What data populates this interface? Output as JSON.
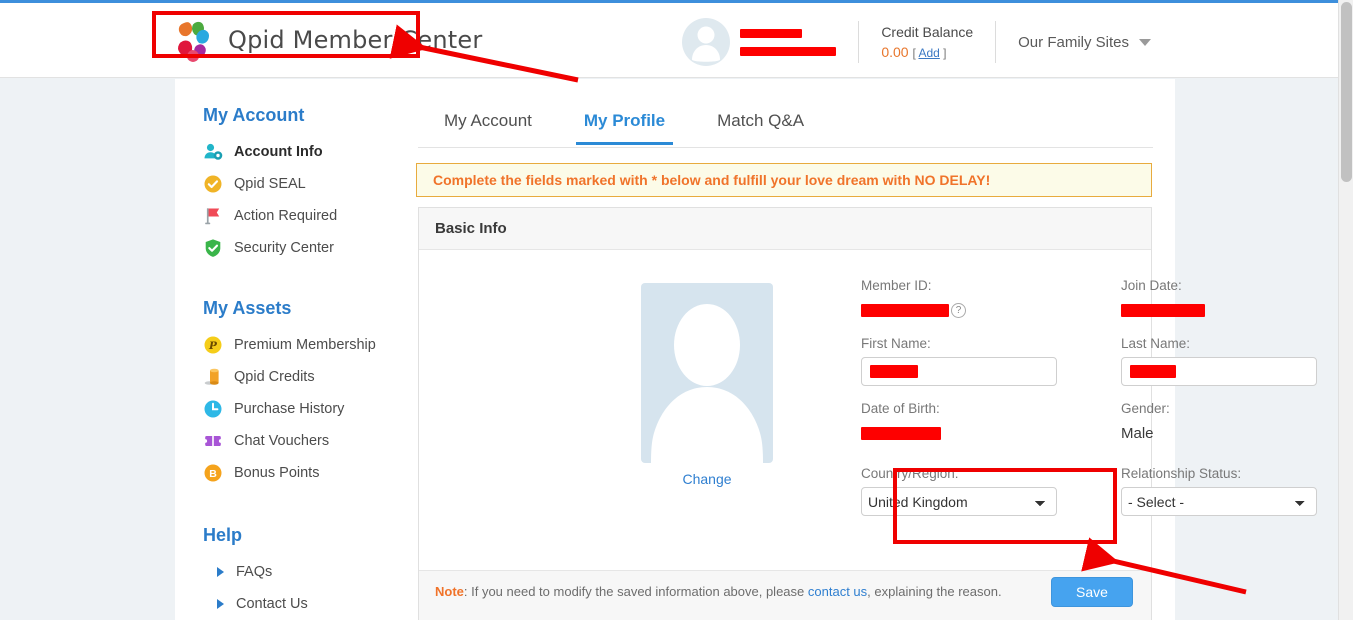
{
  "brand": {
    "title": "Qpid Member Center",
    "logo_icon": "qpid-flower-logo",
    "logo_colors": [
      "#e8762c",
      "#4caa3f",
      "#29a9e0",
      "#a62a9e",
      "#e0173c",
      "#e8486e"
    ]
  },
  "header": {
    "avatar_icon": "user-avatar-icon",
    "username_redacted": true,
    "credit": {
      "label": "Credit Balance",
      "value": "0.00",
      "add_open": "[",
      "add_label": "Add",
      "add_close": "]"
    },
    "family_sites": {
      "label": "Our Family Sites",
      "caret_icon": "chevron-down-icon"
    }
  },
  "sidebar": {
    "sections": [
      {
        "title": "My Account",
        "items": [
          {
            "label": "Account Info",
            "icon": "user-gear-icon",
            "active": true
          },
          {
            "label": "Qpid SEAL",
            "icon": "check-circle-yellow-icon",
            "active": false
          },
          {
            "label": "Action Required",
            "icon": "red-flag-icon",
            "active": false
          },
          {
            "label": "Security Center",
            "icon": "shield-check-green-icon",
            "active": false
          }
        ]
      },
      {
        "title": "My Assets",
        "items": [
          {
            "label": "Premium Membership",
            "icon": "premium-p-badge-icon",
            "active": false
          },
          {
            "label": "Qpid Credits",
            "icon": "coins-icon",
            "active": false
          },
          {
            "label": "Purchase History",
            "icon": "clock-icon",
            "active": false
          },
          {
            "label": "Chat Vouchers",
            "icon": "ticket-icon",
            "active": false
          },
          {
            "label": "Bonus Points",
            "icon": "bonus-b-badge-icon",
            "active": false
          }
        ]
      }
    ],
    "help": {
      "title": "Help",
      "items": [
        {
          "label": "FAQs",
          "icon": "triangle-right-icon"
        },
        {
          "label": "Contact Us",
          "icon": "triangle-right-icon"
        }
      ]
    }
  },
  "tabs": [
    {
      "label": "My Account",
      "active": false
    },
    {
      "label": "My Profile",
      "active": true
    },
    {
      "label": "Match Q&A",
      "active": false
    }
  ],
  "alert": {
    "text": "Complete the fields marked with * below and fulfill your love dream with NO DELAY!"
  },
  "panel": {
    "title": "Basic Info",
    "photo": {
      "placeholder_icon": "person-silhouette-icon",
      "change_label": "Change"
    },
    "fields": {
      "member_id": {
        "label": "Member ID:",
        "value": "",
        "redacted": true,
        "help_icon": "question-mark-icon"
      },
      "join_date": {
        "label": "Join Date:",
        "value": "",
        "redacted": true
      },
      "first_name": {
        "label": "First Name:",
        "value": "",
        "redacted": true
      },
      "last_name": {
        "label": "Last Name:",
        "value": "",
        "redacted": true
      },
      "date_of_birth": {
        "label": "Date of Birth:",
        "value": "",
        "redacted": true
      },
      "gender": {
        "label": "Gender:",
        "value": "Male"
      },
      "country": {
        "label": "Country/Region:",
        "selected": "United Kingdom",
        "options": [
          "United Kingdom"
        ]
      },
      "relationship_status": {
        "label": "Relationship Status:",
        "selected": "- Select -",
        "options": [
          "- Select -"
        ]
      }
    },
    "footer": {
      "note_prefix": "Note",
      "note_body_1": ": If you need to modify the saved information above, please ",
      "note_link": "contact us",
      "note_body_2": ", explaining the reason.",
      "save_label": "Save"
    }
  },
  "annotations": {
    "highlight_boxes": [
      {
        "name": "logo-highlight",
        "target": "brand-logo-title"
      },
      {
        "name": "relationship-status-highlight",
        "target": "relationship-status-select"
      }
    ],
    "arrows": [
      {
        "name": "arrow-to-logo",
        "direction": "up-left"
      },
      {
        "name": "arrow-to-relationship-status",
        "direction": "up-left"
      }
    ],
    "color": "#ef0000"
  },
  "scrollbar": {
    "orientation": "vertical"
  }
}
